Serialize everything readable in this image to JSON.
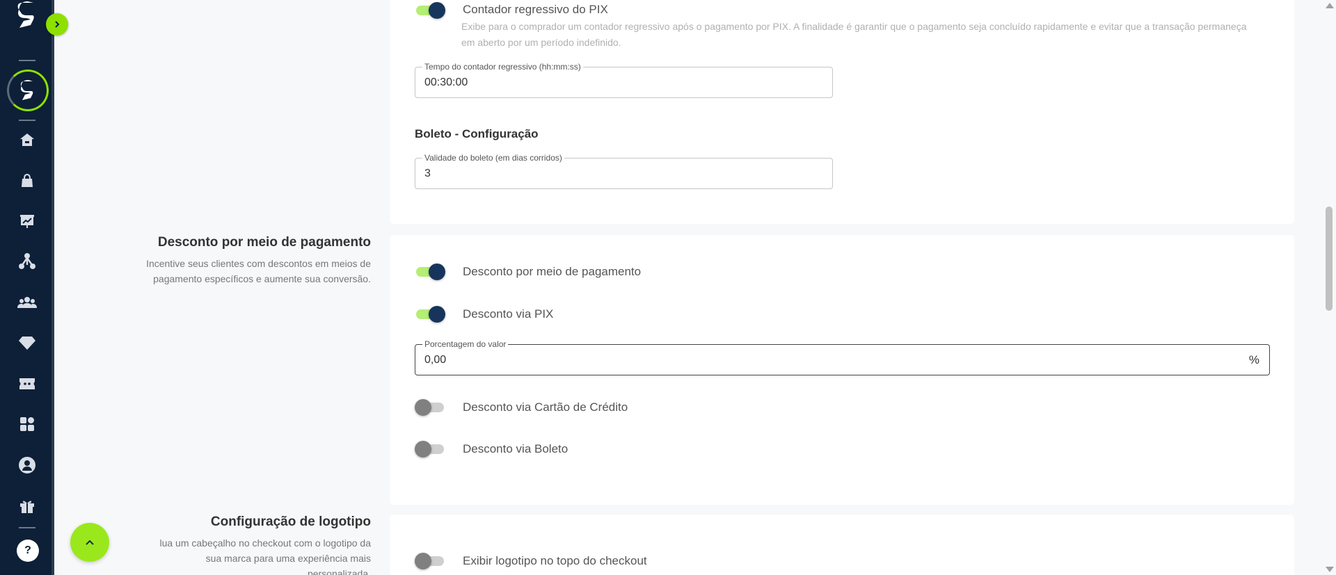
{
  "colors": {
    "sidebar": "#0d2038",
    "accent": "#8ee000",
    "toggle_on": "#17355c",
    "toggle_off": "#808080"
  },
  "sidebar": {
    "nav_icons": [
      "home-icon",
      "shopping-bag-icon",
      "chart-board-icon",
      "network-icon",
      "users-icon",
      "diamond-icon",
      "ticket-icon",
      "apps-grid-icon",
      "profile-icon",
      "gift-icon"
    ],
    "help_label": "?"
  },
  "pix_card": {
    "countdown_toggle": {
      "label": "Contador regressivo do PIX",
      "on": true
    },
    "countdown_help": "Exibe para o comprador um contador regressivo após o pagamento por PIX. A finalidade é garantir que o pagamento seja concluído rapidamente e evitar que a transação permaneça em aberto por um período indefinido.",
    "countdown_field": {
      "label": "Tempo do contador regressivo (hh:mm:ss)",
      "value": "00:30:00"
    },
    "boleto_title": "Boleto - Configuração",
    "boleto_field": {
      "label": "Validade do boleto (em dias corridos)",
      "value": "3"
    }
  },
  "discount_section": {
    "title": "Desconto por meio de pagamento",
    "description": "Incentive seus clientes com descontos em meios de pagamento específicos e aumente sua conversão.",
    "toggle_main": {
      "label": "Desconto por meio de pagamento",
      "on": true
    },
    "toggle_pix": {
      "label": "Desconto via PIX",
      "on": true
    },
    "percent_field": {
      "label": "Porcentagem do valor",
      "value": "0,00",
      "suffix": "%"
    },
    "toggle_card": {
      "label": "Desconto via Cartão de Crédito",
      "on": false
    },
    "toggle_boleto": {
      "label": "Desconto via Boleto",
      "on": false
    }
  },
  "logo_section": {
    "title": "Configuração de logotipo",
    "description": "lua um cabeçalho no checkout com o logotipo da sua marca para uma experiência mais personalizada.",
    "toggle_logo": {
      "label": "Exibir logotipo no topo do checkout",
      "on": false
    }
  }
}
